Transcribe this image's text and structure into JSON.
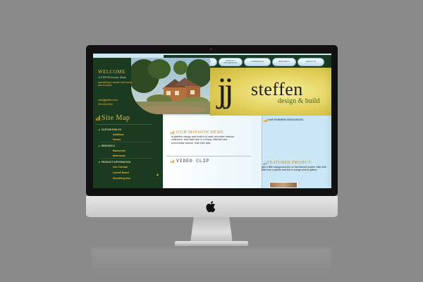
{
  "site": {
    "logo": {
      "jj": "jj",
      "name": "steffen",
      "tagline": "design & build"
    },
    "nav": {
      "tabs": [
        {
          "label": "CUSTOM BUILDS"
        },
        {
          "label": "REMODELS"
        },
        {
          "label": "PRODUCT INFORMATION"
        },
        {
          "label": "COMMERCIAL"
        },
        {
          "label": "REMODELS"
        },
        {
          "label": "ABOUT US"
        }
      ]
    },
    "welcome": {
      "title": "WELCOME",
      "address": "JJ STEFFEN morton, illinois",
      "specialty": "specializing in custom built homes and remodels",
      "email": "info@jjsteffen.com",
      "phone": "309.263.0000"
    },
    "sitemap": {
      "title": "Site Map",
      "items": [
        {
          "label": "CUSTOM BUILDS",
          "level": "top"
        },
        {
          "label": "Additions",
          "level": "sub"
        },
        {
          "label": "Homes",
          "level": "sub"
        },
        {
          "label": "REMODELS",
          "level": "top"
        },
        {
          "label": "Basements",
          "level": "sub"
        },
        {
          "label": "Bathrooms",
          "level": "sub"
        },
        {
          "label": "PRODUCT INFORMATION",
          "level": "top"
        },
        {
          "label": "Geo Thermal",
          "level": "sub"
        },
        {
          "label": "Lunnell Board",
          "level": "sub"
        },
        {
          "label": "Something else",
          "level": "sub"
        }
      ]
    },
    "mission": {
      "title": "OUR MISSION HERE",
      "text": "at jjsteffen design and build is to write out entire mission statement. blah blah blah in a timely, effective and economical manner. blah blah blah."
    },
    "video": {
      "title": "VIDEO CLIP"
    },
    "partners": {
      "title": "OUR PARNERS RESOURCES"
    },
    "featured": {
      "title": "FEATURED PROJECT:",
      "text": "give a little background info on the featured project. blah blah blah here a picture and link to orange print to gallery."
    },
    "colors": {
      "left_column": "#1a3b20",
      "accent_gold": "#e9b53a",
      "banner_yellow": "#e2d15c",
      "content_blue": "#cbe7f6"
    }
  }
}
